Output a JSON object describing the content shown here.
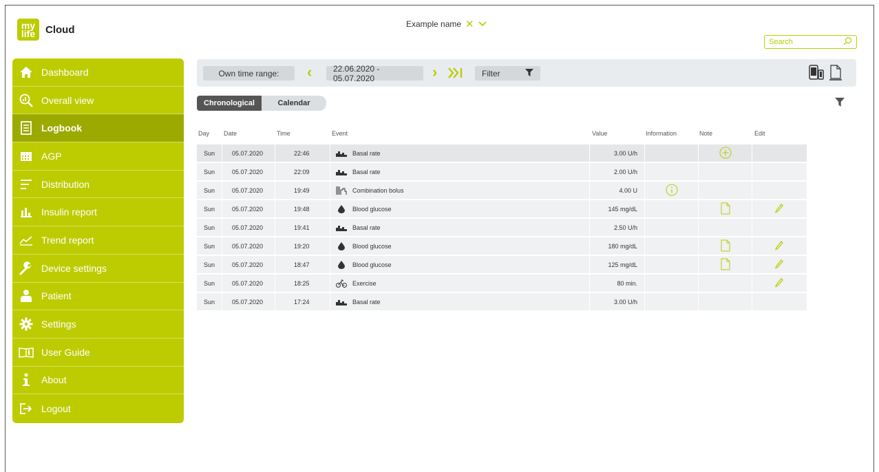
{
  "app": {
    "logo_top": "my",
    "logo_bottom": "life",
    "name": "Cloud"
  },
  "user": {
    "name": "Example name"
  },
  "search": {
    "placeholder": "Search"
  },
  "colors": {
    "accent": "#bdcc00",
    "accent_dark": "#9caa00",
    "toolbar_bg": "#e9ecef",
    "row_bg": "#eff1f3"
  },
  "sidebar": {
    "items": [
      {
        "label": "Dashboard",
        "icon": "home-icon"
      },
      {
        "label": "Overall view",
        "icon": "magnifier-chart-icon"
      },
      {
        "label": "Logbook",
        "icon": "logbook-icon",
        "active": true
      },
      {
        "label": "AGP",
        "icon": "calendar-icon"
      },
      {
        "label": "Distribution",
        "icon": "distribution-icon"
      },
      {
        "label": "Insulin report",
        "icon": "bar-chart-icon"
      },
      {
        "label": "Trend report",
        "icon": "trend-icon"
      },
      {
        "label": "Device settings",
        "icon": "wrench-icon"
      },
      {
        "label": "Patient",
        "icon": "patient-icon"
      },
      {
        "label": "Settings",
        "icon": "gear-icon"
      },
      {
        "label": "User Guide",
        "icon": "book-icon"
      },
      {
        "label": "About",
        "icon": "info-icon"
      },
      {
        "label": "Logout",
        "icon": "logout-icon"
      }
    ]
  },
  "toolbar": {
    "own_range_label": "Own time range:",
    "date_range": "22.06.2020 - 05.07.2020",
    "filter_label": "Filter",
    "icons": [
      "device-icon",
      "pdf-document-icon"
    ]
  },
  "tabs": [
    {
      "label": "Chronological",
      "active": true
    },
    {
      "label": "Calendar",
      "active": false
    }
  ],
  "table": {
    "headers": {
      "day": "Day",
      "date": "Date",
      "time": "Time",
      "event": "Event",
      "value": "Value",
      "information": "Information",
      "note": "Note",
      "edit": "Edit"
    },
    "rows": [
      {
        "day": "Sun",
        "date": "05.07.2020",
        "time": "22:46",
        "event": "Basal rate",
        "event_icon": "basal-rate-icon",
        "value": "3.00 U/h",
        "info": false,
        "note": "add",
        "edit": false
      },
      {
        "day": "Sun",
        "date": "05.07.2020",
        "time": "22:09",
        "event": "Basal rate",
        "event_icon": "basal-rate-icon",
        "value": "2.00 U/h",
        "info": false,
        "note": "",
        "edit": false
      },
      {
        "day": "Sun",
        "date": "05.07.2020",
        "time": "19:49",
        "event": "Combination bolus",
        "event_icon": "combination-bolus-icon",
        "value": "4.00 U",
        "info": true,
        "note": "",
        "edit": false
      },
      {
        "day": "Sun",
        "date": "05.07.2020",
        "time": "19:48",
        "event": "Blood glucose",
        "event_icon": "blood-drop-icon",
        "value": "145 mg/dL",
        "info": false,
        "note": "doc",
        "edit": true
      },
      {
        "day": "Sun",
        "date": "05.07.2020",
        "time": "19:41",
        "event": "Basal rate",
        "event_icon": "basal-rate-icon",
        "value": "2.50 U/h",
        "info": false,
        "note": "",
        "edit": false
      },
      {
        "day": "Sun",
        "date": "05.07.2020",
        "time": "19:20",
        "event": "Blood glucose",
        "event_icon": "blood-drop-icon",
        "value": "180 mg/dL",
        "info": false,
        "note": "doc",
        "edit": true
      },
      {
        "day": "Sun",
        "date": "05.07.2020",
        "time": "18:47",
        "event": "Blood glucose",
        "event_icon": "blood-drop-icon",
        "value": "125 mg/dL",
        "info": false,
        "note": "doc",
        "edit": true
      },
      {
        "day": "Sun",
        "date": "05.07.2020",
        "time": "18:25",
        "event": "Exercise",
        "event_icon": "bicycle-icon",
        "value": "80 min.",
        "info": false,
        "note": "",
        "edit": true
      },
      {
        "day": "Sun",
        "date": "05.07.2020",
        "time": "17:24",
        "event": "Basal rate",
        "event_icon": "basal-rate-icon",
        "value": "3.00 U/h",
        "info": false,
        "note": "",
        "edit": false
      }
    ]
  }
}
